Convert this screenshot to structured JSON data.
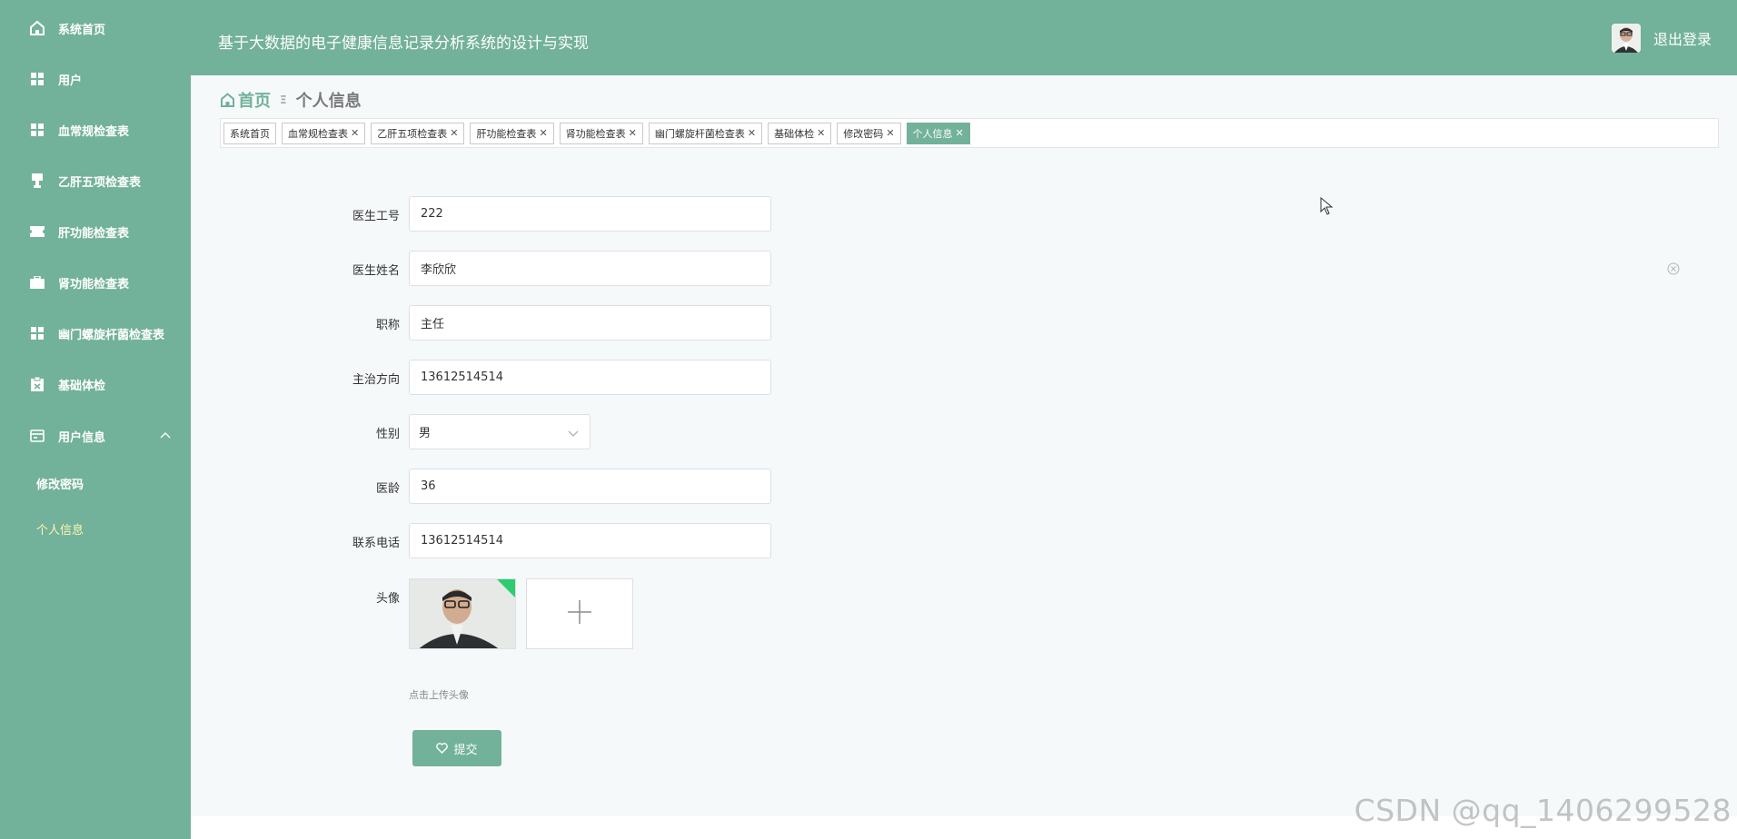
{
  "app": {
    "title": "基于大数据的电子健康信息记录分析系统的设计与实现",
    "logout_label": "退出登录"
  },
  "sidebar": {
    "items": [
      {
        "label": "系统首页",
        "icon": "home-icon"
      },
      {
        "label": "用户",
        "icon": "grid-icon"
      },
      {
        "label": "血常规检查表",
        "icon": "grid-icon"
      },
      {
        "label": "乙肝五项检查表",
        "icon": "cup-icon"
      },
      {
        "label": "肝功能检查表",
        "icon": "ticket-icon"
      },
      {
        "label": "肾功能检查表",
        "icon": "briefcase-icon"
      },
      {
        "label": "幽门螺旋杆菌检查表",
        "icon": "grid-icon"
      },
      {
        "label": "基础体检",
        "icon": "clipboard-icon"
      },
      {
        "label": "用户信息",
        "icon": "card-icon"
      }
    ],
    "sub_items": [
      {
        "label": "修改密码"
      },
      {
        "label": "个人信息"
      }
    ]
  },
  "breadcrumb": {
    "home": "首页",
    "separator": "Ξ",
    "current": "个人信息"
  },
  "tabs": [
    {
      "label": "系统首页",
      "closable": false
    },
    {
      "label": "血常规检查表",
      "closable": true
    },
    {
      "label": "乙肝五项检查表",
      "closable": true
    },
    {
      "label": "肝功能检查表",
      "closable": true
    },
    {
      "label": "肾功能检查表",
      "closable": true
    },
    {
      "label": "幽门螺旋杆菌检查表",
      "closable": true
    },
    {
      "label": "基础体检",
      "closable": true
    },
    {
      "label": "修改密码",
      "closable": true
    },
    {
      "label": "个人信息",
      "closable": true,
      "active": true
    }
  ],
  "form": {
    "doctor_id": {
      "label": "医生工号",
      "value": "222"
    },
    "doctor_name": {
      "label": "医生姓名",
      "value": "李欣欣"
    },
    "title": {
      "label": "职称",
      "value": "主任"
    },
    "specialty": {
      "label": "主治方向",
      "value": "13612514514"
    },
    "gender": {
      "label": "性别",
      "value": "男"
    },
    "years": {
      "label": "医龄",
      "value": "36"
    },
    "phone": {
      "label": "联系电话",
      "value": "13612514514"
    },
    "avatar": {
      "label": "头像",
      "hint": "点击上传头像"
    },
    "submit_label": "提交"
  },
  "watermark": "CSDN @qq_1406299528",
  "colors": {
    "primary": "#72b19a",
    "active_sub": "#fff6b0"
  }
}
